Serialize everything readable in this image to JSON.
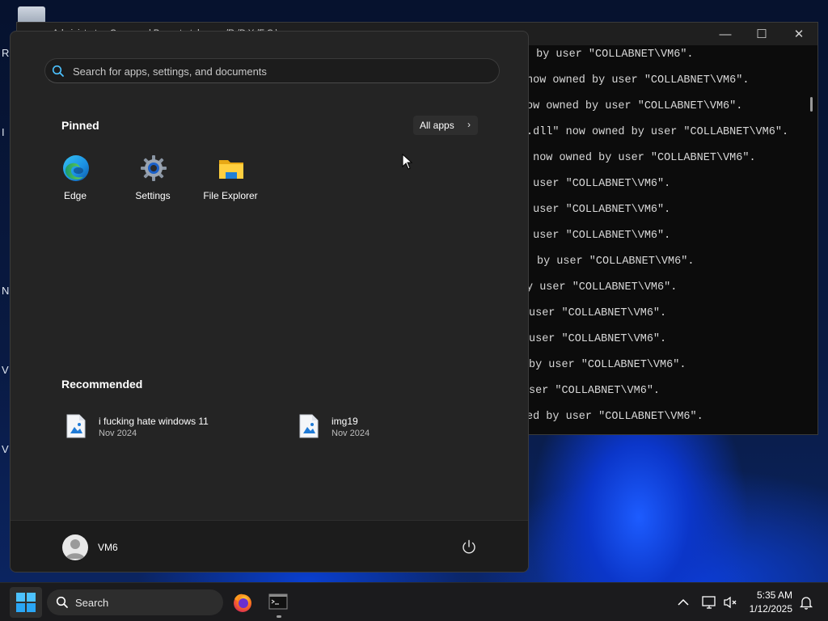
{
  "desktop": {
    "edge_letters": [
      "R",
      "I",
      "N",
      "V",
      "V"
    ]
  },
  "terminal": {
    "title": "Administrator: Command Prompt - takeown /R /D Y /F C:\\",
    "lines": [
      " by user \"COLLABNET\\VM6\".",
      "now owned by user \"COLLABNET\\VM6\".",
      "ow owned by user \"COLLABNET\\VM6\".",
      ".dll\" now owned by user \"COLLABNET\\VM6\".",
      " now owned by user \"COLLABNET\\VM6\".",
      " user \"COLLABNET\\VM6\".",
      " user \"COLLABNET\\VM6\".",
      " user \"COLLABNET\\VM6\".",
      "by user \"COLLABNET\\VM6\".",
      "y user \"COLLABNET\\VM6\".",
      "user \"COLLABNET\\VM6\".",
      "user \"COLLABNET\\VM6\".",
      "by user \"COLLABNET\\VM6\".",
      "ser \"COLLABNET\\VM6\".",
      "ed by user \"COLLABNET\\VM6\"."
    ]
  },
  "start_menu": {
    "search_placeholder": "Search for apps, settings, and documents",
    "pinned_title": "Pinned",
    "all_apps_label": "All apps",
    "pinned_apps": [
      {
        "label": "Edge",
        "icon": "edge-icon"
      },
      {
        "label": "Settings",
        "icon": "settings-gear-icon"
      },
      {
        "label": "File Explorer",
        "icon": "folder-icon"
      }
    ],
    "recommended_title": "Recommended",
    "recommended": [
      {
        "name": "i fucking hate windows 11",
        "date": "Nov 2024"
      },
      {
        "name": "img19",
        "date": "Nov 2024"
      }
    ],
    "user_name": "VM6"
  },
  "taskbar": {
    "search_label": "Search",
    "time": "5:35 AM",
    "date": "1/12/2025"
  },
  "colors": {
    "accent": "#0067c0",
    "start_bg": "#242424",
    "taskbar_bg": "#1b1b1d",
    "terminal_bg": "#0c0c0c"
  }
}
